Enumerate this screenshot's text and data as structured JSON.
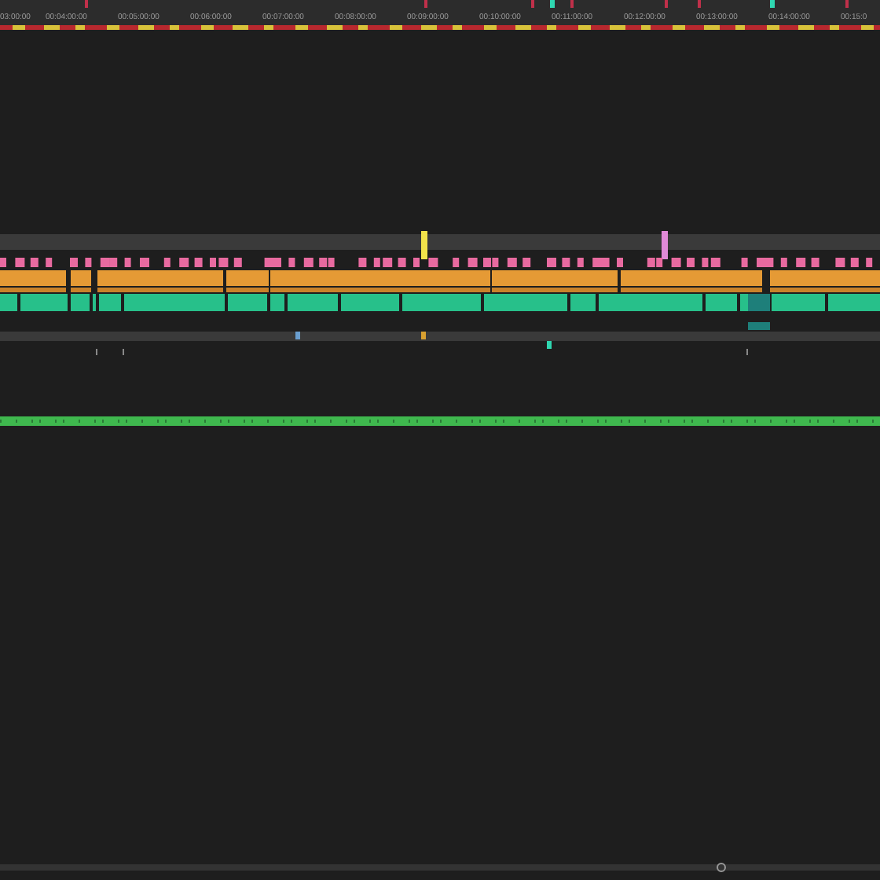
{
  "ruler": {
    "timecodes": [
      "03:00:00",
      "00:04:00:00",
      "00:05:00:00",
      "00:06:00:00",
      "00:07:00:00",
      "00:08:00:00",
      "00:09:00:00",
      "00:10:00:00",
      "00:11:00:00",
      "00:12:00:00",
      "00:13:00:00",
      "00:14:00:00",
      "00:15:0"
    ]
  }
}
